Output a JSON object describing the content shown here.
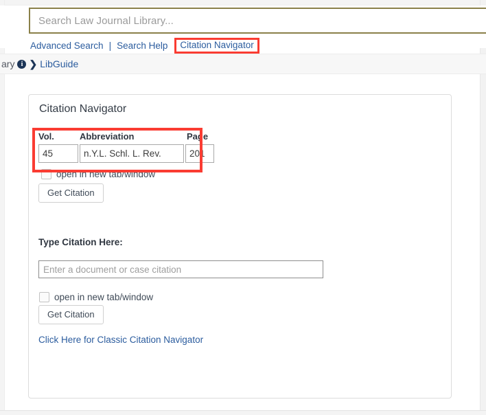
{
  "header": {
    "search": {
      "placeholder": "Search Law Journal Library...",
      "value": "",
      "border_color": "#8a8049"
    },
    "links": {
      "advanced_search": "Advanced Search",
      "separator": "|",
      "search_help": "Search Help",
      "citation_navigator": "Citation Navigator"
    }
  },
  "breadcrumb": {
    "truncated_root": "ary",
    "info_icon_glyph": "i",
    "chevron_glyph": "❯",
    "current": "LibGuide"
  },
  "card": {
    "title": "Citation Navigator",
    "citation_fields": {
      "headers": {
        "vol": "Vol.",
        "abbreviation": "Abbreviation",
        "page": "Page"
      },
      "values": {
        "vol": "45",
        "abbreviation": "n.Y.L. Schl. L. Rev.",
        "page": "201"
      }
    },
    "open_new_tab_label_top": "open in new tab/window",
    "get_citation_label_top": "Get Citation",
    "type_citation_label": "Type Citation Here:",
    "citation_input": {
      "placeholder": "Enter a document or case citation",
      "value": ""
    },
    "open_new_tab_label_bottom": "open in new tab/window",
    "get_citation_label_bottom": "Get Citation",
    "classic_link": "Click Here for Classic Citation Navigator"
  },
  "annotations": {
    "highlight_color": "#fa3c32",
    "boxes": [
      {
        "name": "citation-navigator-link-highlight"
      },
      {
        "name": "citation-fields-highlight"
      }
    ]
  }
}
